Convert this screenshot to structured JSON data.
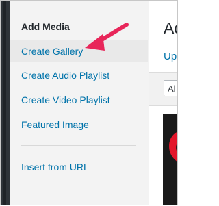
{
  "sidebar": {
    "heading": "Add Media",
    "items": [
      {
        "label": "Create Gallery"
      },
      {
        "label": "Create Audio Playlist"
      },
      {
        "label": "Create Video Playlist"
      },
      {
        "label": "Featured Image"
      },
      {
        "label": "Insert from URL"
      }
    ]
  },
  "main": {
    "title": "Ad",
    "tab": "Upl",
    "filter_value": "Al"
  },
  "annotation": {
    "arrow_color": "#e8265a",
    "thumb_color": "#e3162b"
  }
}
